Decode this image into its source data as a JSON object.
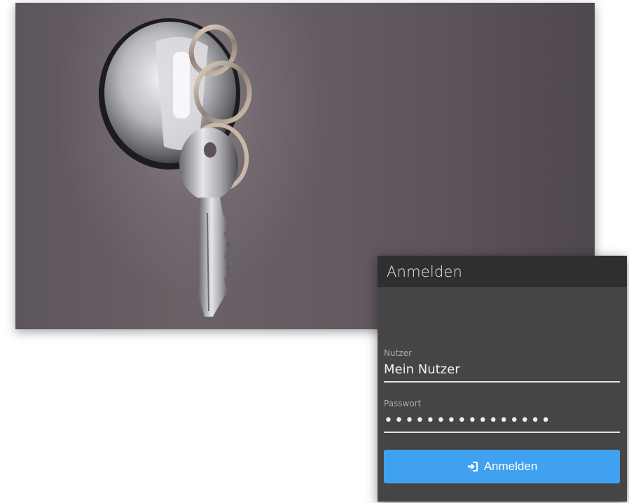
{
  "hero": {
    "image": "key-in-lock-photo",
    "icon": "key-in-lock-illustration"
  },
  "login": {
    "title": "Anmelden",
    "user": {
      "label": "Nutzer",
      "value": "Mein Nutzer"
    },
    "password": {
      "label": "Passwort",
      "value": "••••••••••••••••"
    },
    "submit": {
      "label": "Anmelden",
      "icon": "sign-in-icon",
      "color": "#3fa1ef"
    }
  },
  "colors": {
    "panel": "#454545",
    "panel_header": "#2f2f30",
    "accent": "#3fa1ef"
  }
}
